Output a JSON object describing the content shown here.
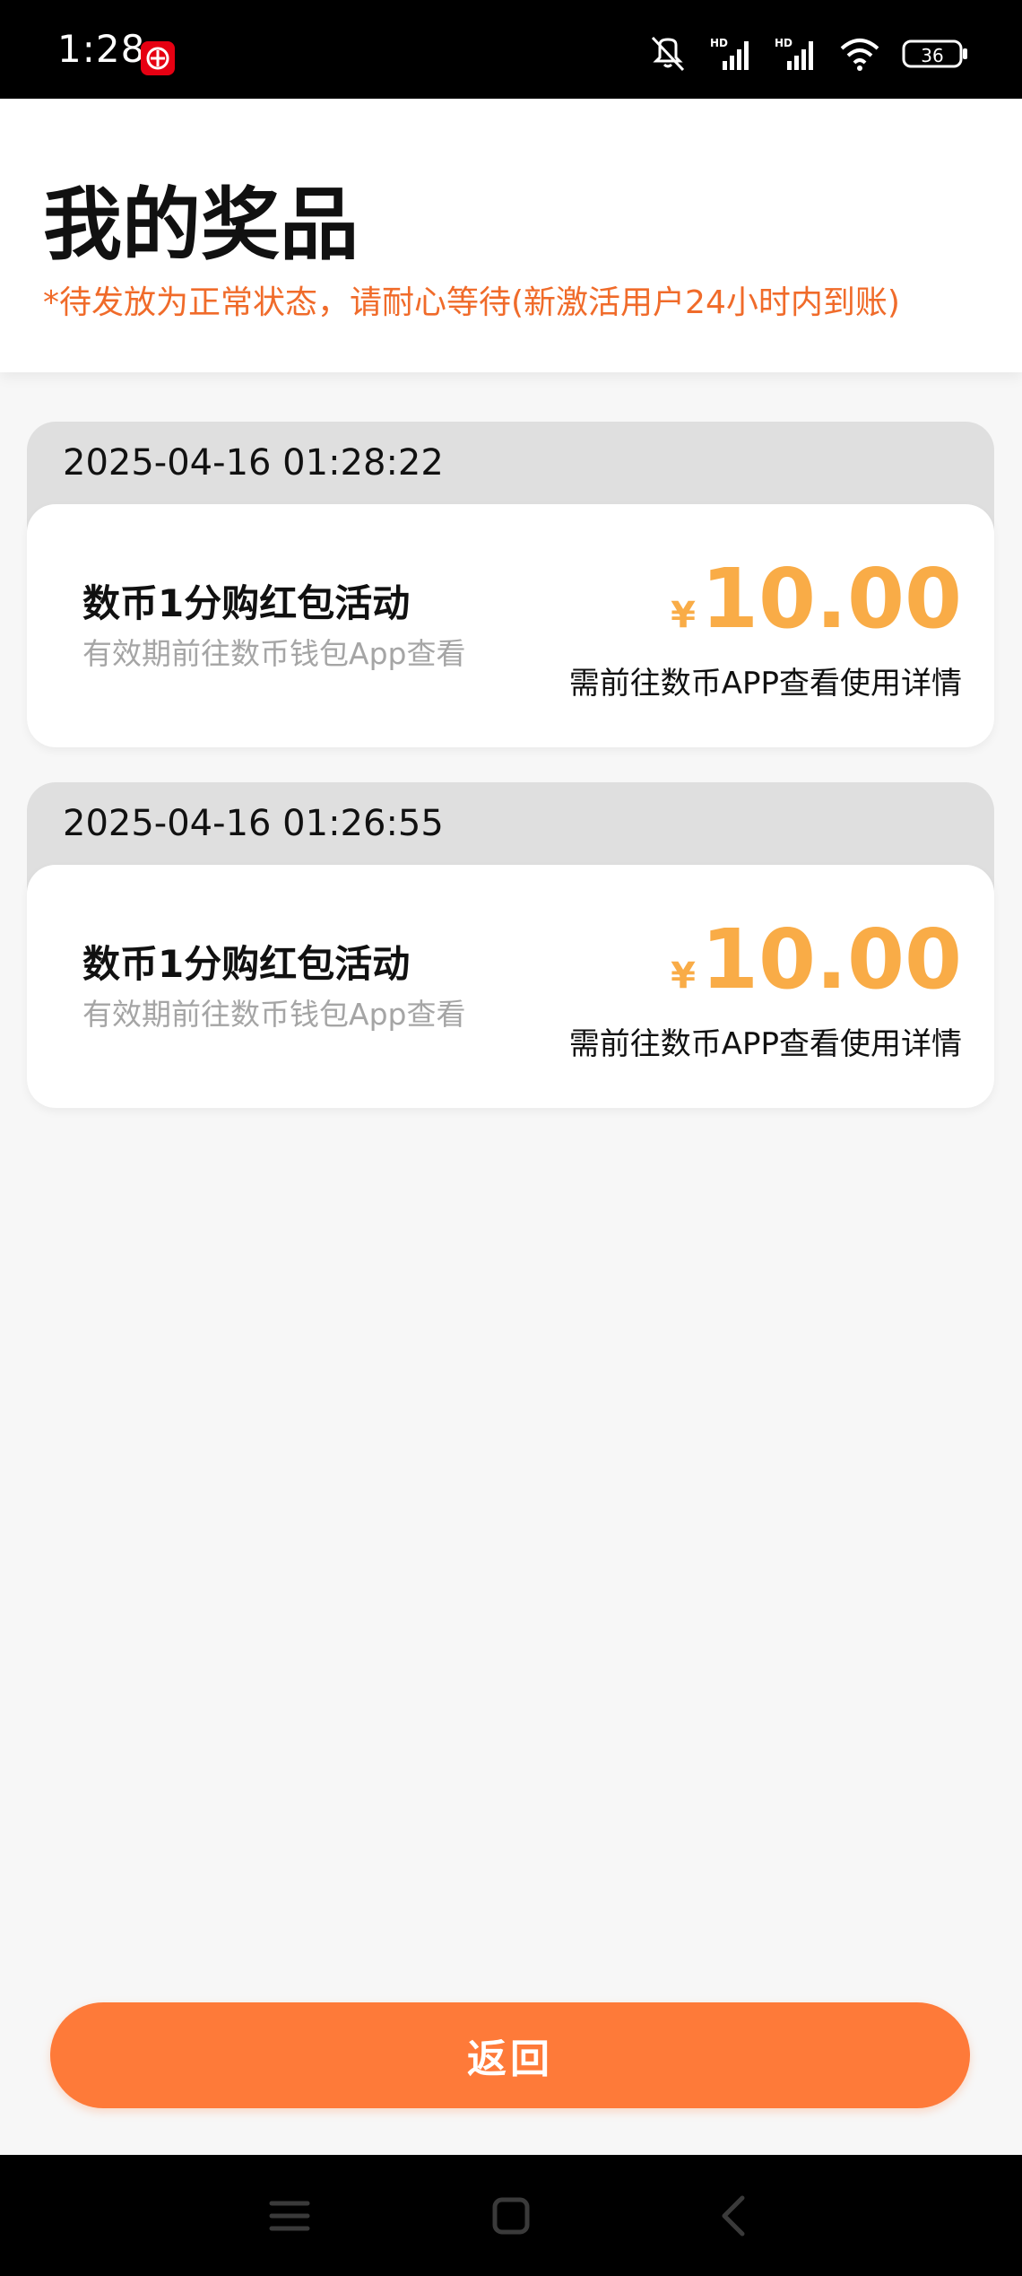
{
  "status_bar": {
    "time": "1:28",
    "battery": "36",
    "network_label": "HD"
  },
  "header": {
    "title": "我的奖品",
    "notice": "*待发放为正常状态，请耐心等待(新激活用户24小时内到账)"
  },
  "prizes": [
    {
      "time": "2025-04-16 01:28:22",
      "name": "数币1分购红包活动",
      "subtitle": "有效期前往数币钱包App查看",
      "currency": "¥",
      "amount": "10.00",
      "note": "需前往数币APP查看使用详情"
    },
    {
      "time": "2025-04-16 01:26:55",
      "name": "数币1分购红包活动",
      "subtitle": "有效期前往数币钱包App查看",
      "currency": "¥",
      "amount": "10.00",
      "note": "需前往数币APP查看使用详情"
    }
  ],
  "footer": {
    "return_label": "返回"
  },
  "colors": {
    "accent": "#fe7a39",
    "notice": "#f06b2a",
    "amount": "#f9ac47"
  },
  "icons": {
    "status_app": "digital-rmb-icon",
    "mute": "vibrate-off-icon",
    "signal": "signal-icon",
    "wifi": "wifi-icon",
    "battery": "battery-icon",
    "menu": "menu-icon",
    "home": "home-icon",
    "back": "back-icon"
  }
}
